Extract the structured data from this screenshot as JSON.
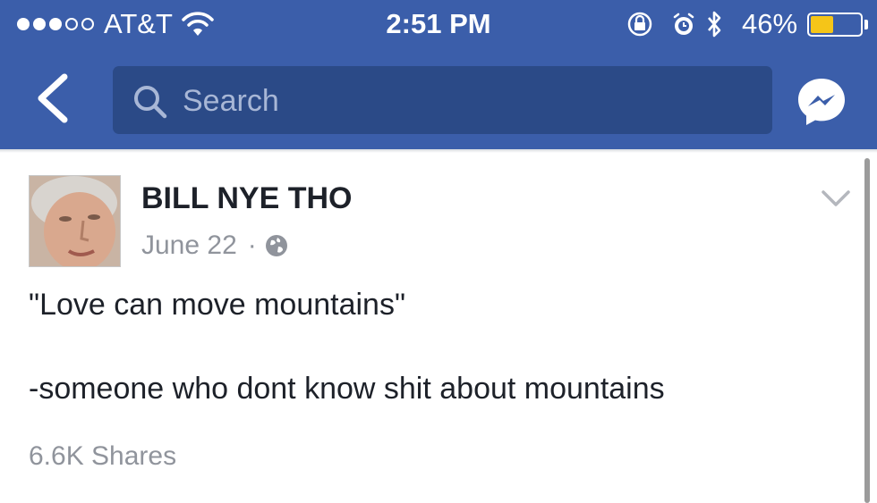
{
  "status_bar": {
    "carrier": "AT&T",
    "time": "2:51 PM",
    "battery_percent": "46%",
    "battery_level": 0.46,
    "signal_bars_filled": 3,
    "signal_bars_total": 5,
    "icons": [
      "wifi-icon",
      "rotation-lock-icon",
      "alarm-icon",
      "bluetooth-icon",
      "battery-icon"
    ]
  },
  "nav": {
    "back_icon": "back-chevron-icon",
    "search_placeholder": "Search",
    "messenger_icon": "messenger-icon"
  },
  "post": {
    "author": "BILL NYE THO",
    "date": "June 22",
    "separator": "·",
    "privacy_icon": "globe-icon",
    "lines": [
      "\"Love can move mountains\"",
      "-someone who dont know shit about mountains"
    ],
    "shares": "6.6K Shares",
    "options_icon": "chevron-down-icon"
  },
  "colors": {
    "header": "#3b5eaa",
    "search_bg": "#2b4a87",
    "text": "#1d2129",
    "muted": "#90949c",
    "battery": "#f5c518"
  }
}
